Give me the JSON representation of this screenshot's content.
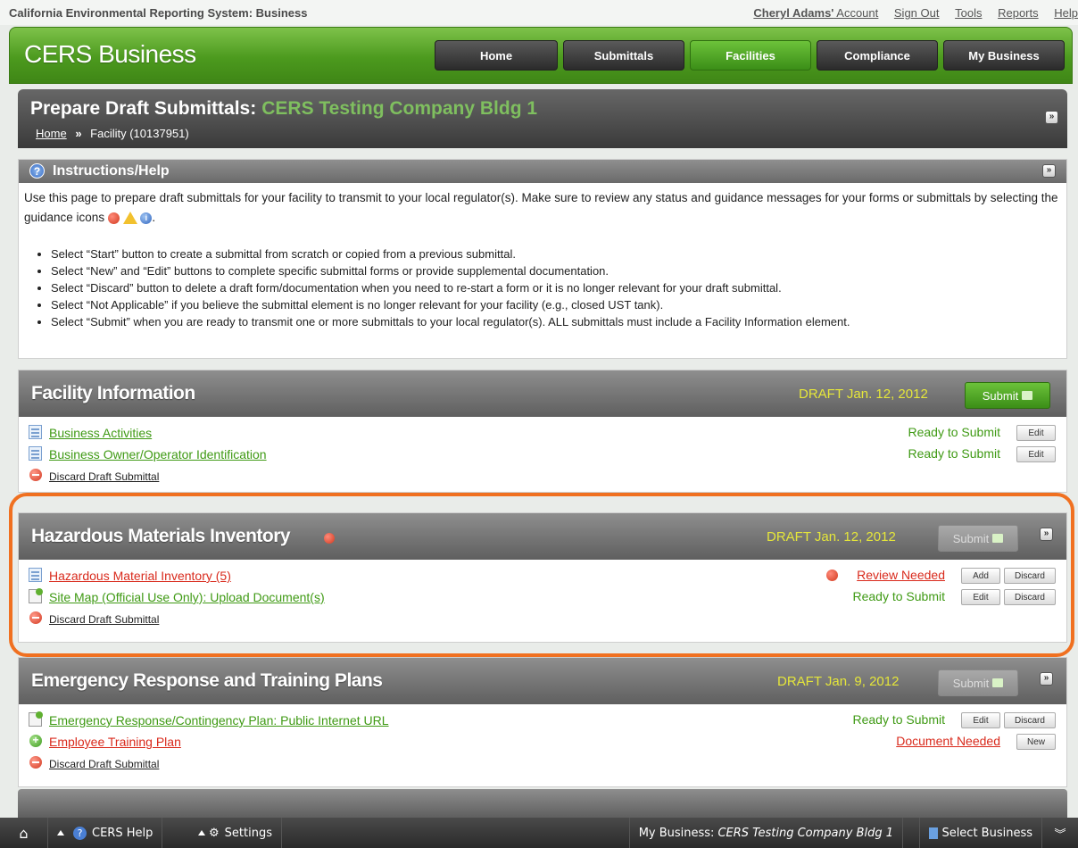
{
  "topbar": {
    "system_title": "California Environmental Reporting System: Business",
    "account_name": "Cheryl Adams'",
    "account_label": " Account",
    "sign_out": "Sign Out",
    "tools": "Tools",
    "reports": "Reports",
    "help": "Help"
  },
  "header": {
    "brand": "CERS Business",
    "nav": [
      "Home",
      "Submittals",
      "Facilities",
      "Compliance",
      "My Business"
    ],
    "active_nav": "Facilities"
  },
  "page": {
    "title_prefix": "Prepare Draft Submittals:",
    "facility_name": "CERS Testing Company Bldg 1",
    "breadcrumb_home": "Home",
    "breadcrumb_sep": "»",
    "breadcrumb_current": "Facility (10137951)"
  },
  "instructions": {
    "title": "Instructions/Help",
    "intro": "Use this page to prepare draft submittals for your facility to transmit to your local regulator(s). Make sure to review any status and guidance messages for your forms or submittals by selecting the guidance icons",
    "items": [
      "Select “Start” button to create a submittal from scratch or copied from a previous submittal.",
      "Select “New” and “Edit” buttons to complete specific submittal forms or provide supplemental documentation.",
      "Select “Discard” button to delete a draft form/documentation when you need to re-start a form or it is no longer relevant for your draft submittal.",
      "Select “Not Applicable” if you believe the submittal element is no longer relevant for your facility (e.g., closed UST tank).",
      "Select “Submit” when you are ready to transmit one or more submittals to your local regulator(s). ALL submittals must include a Facility Information element."
    ]
  },
  "sections": [
    {
      "title": "Facility Information",
      "draft": "DRAFT Jan. 12, 2012",
      "submit_label": "Submit",
      "rows": [
        {
          "label": "Business Activities",
          "status": "Ready to Submit",
          "buttons": [
            "Edit"
          ]
        },
        {
          "label": "Business Owner/Operator Identification",
          "status": "Ready to Submit",
          "buttons": [
            "Edit"
          ]
        }
      ],
      "discard_label": "Discard Draft Submittal"
    },
    {
      "title": "Hazardous Materials Inventory",
      "draft": "DRAFT Jan. 12, 2012",
      "submit_label": "Submit",
      "rows": [
        {
          "label": "Hazardous Material Inventory (5)",
          "status": "Review Needed",
          "buttons": [
            "Add",
            "Discard"
          ]
        },
        {
          "label": "Site Map (Official Use Only): Upload Document(s)",
          "status": "Ready to Submit",
          "buttons": [
            "Edit",
            "Discard"
          ]
        }
      ],
      "discard_label": "Discard Draft Submittal"
    },
    {
      "title": "Emergency Response and Training Plans",
      "draft": "DRAFT Jan. 9, 2012",
      "submit_label": "Submit",
      "rows": [
        {
          "label": "Emergency Response/Contingency Plan: Public Internet URL",
          "status": "Ready to Submit",
          "buttons": [
            "Edit",
            "Discard"
          ]
        },
        {
          "label": "Employee Training Plan",
          "status": "Document Needed",
          "buttons": [
            "New"
          ]
        }
      ],
      "discard_label": "Discard Draft Submittal"
    }
  ],
  "bottombar": {
    "help": "CERS Help",
    "settings": "Settings",
    "mybusiness_label": "My Business:",
    "mybusiness_name": "CERS Testing Company Bldg 1",
    "select_business": "Select Business"
  },
  "colors": {
    "brand_green": "#4c9a1e",
    "ready_green": "#3f9a14",
    "needed_red": "#d92a1c",
    "draft_yellow": "#e5e63a",
    "highlight_orange": "#f07020"
  }
}
